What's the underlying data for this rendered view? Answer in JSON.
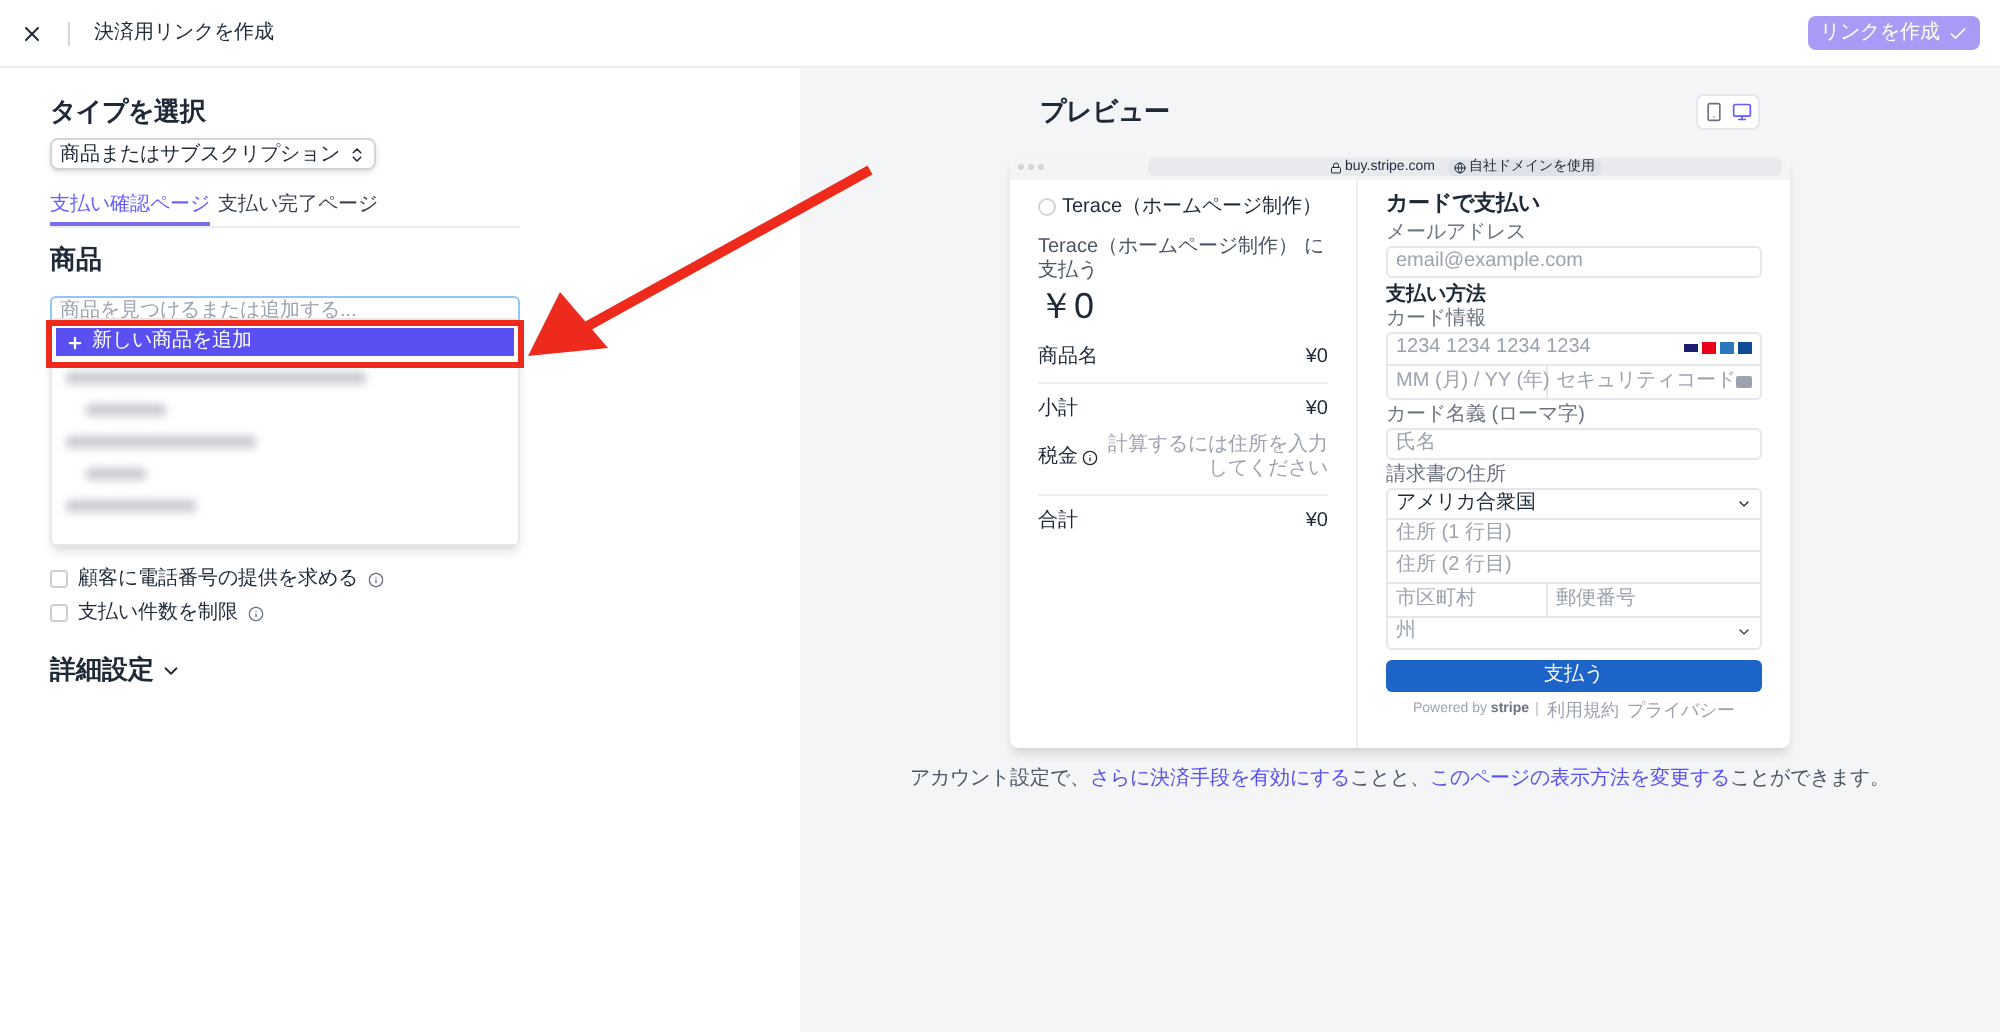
{
  "header": {
    "title": "決済用リンクを作成",
    "create_button": "リンクを作成"
  },
  "form": {
    "type_heading": "タイプを選択",
    "type_select": "商品またはサブスクリプション",
    "tabs": [
      {
        "label": "支払い確認ページ",
        "selected": true
      },
      {
        "label": "支払い完了ページ",
        "selected": false
      }
    ],
    "product_heading": "商品",
    "search": {
      "placeholder": "商品を見つけるまたは追加する..."
    },
    "dropdown": {
      "expanded": true,
      "add_item": "新しい商品を追加"
    },
    "options": [
      {
        "label": "顧客に電話番号の提供を求める",
        "checked": false
      },
      {
        "label": "支払い件数を制限",
        "checked": false
      }
    ],
    "advanced": "詳細設定"
  },
  "preview": {
    "heading": "プレビュー",
    "devices": [
      {
        "kind": "mobile",
        "selected": false
      },
      {
        "kind": "desktop",
        "selected": true
      }
    ],
    "browser": {
      "url": "buy.stripe.com",
      "domain_button": "自社ドメインを使用"
    },
    "summary": {
      "merchant": "Terace（ホームページ制作）",
      "pay_to": "Terace（ホームページ制作） に支払う",
      "amount": "￥0",
      "lines": [
        {
          "kind": "item",
          "label": "商品名",
          "value": "¥0"
        },
        {
          "kind": "subtotal",
          "label": "小計",
          "value": "¥0"
        },
        {
          "kind": "tax",
          "label": "税金",
          "value": "計算するには住所を入力してください"
        },
        {
          "kind": "total",
          "label": "合計",
          "value": "¥0"
        }
      ]
    },
    "payment": {
      "title": "カードで支払い",
      "email_label": "メールアドレス",
      "email_placeholder": "email@example.com",
      "method_heading": "支払い方法",
      "card_label": "カード情報",
      "card_number_placeholder": "1234 1234 1234 1234",
      "expiry_placeholder": "MM (月) / YY (年)",
      "cvc_placeholder": "セキュリティコード",
      "name_label": "カード名義 (ローマ字)",
      "name_placeholder": "氏名",
      "address_label": "請求書の住所",
      "country": "アメリカ合衆国",
      "line1_placeholder": "住所 (1 行目)",
      "line2_placeholder": "住所 (2 行目)",
      "city_placeholder": "市区町村",
      "postal_placeholder": "郵便番号",
      "state_placeholder": "州",
      "pay_button": "支払う",
      "powered_by": "Powered by",
      "brand": "stripe",
      "links": [
        "利用規約",
        "プライバシー"
      ]
    },
    "note": [
      {
        "text": "アカウント設定で、",
        "link": false
      },
      {
        "text": "さらに決済手段を有効にする",
        "link": true
      },
      {
        "text": "ことと、",
        "link": false
      },
      {
        "text": "このページの表示方法を変更する",
        "link": true
      },
      {
        "text": "ことができます。",
        "link": false
      }
    ]
  }
}
